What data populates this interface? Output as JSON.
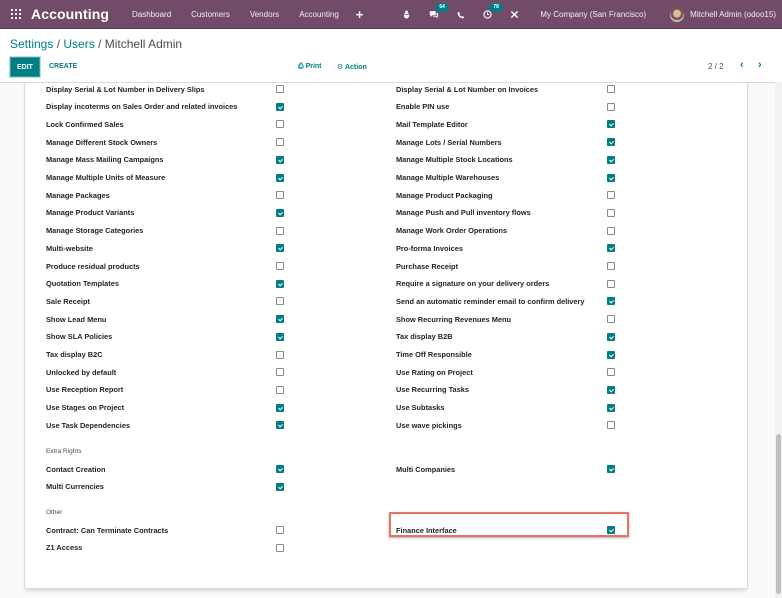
{
  "navbar": {
    "apps_icon": "apps-grid-icon",
    "brand": "Accounting",
    "menu": [
      "Dashboard",
      "Customers",
      "Vendors",
      "Accounting"
    ],
    "plus": "+",
    "icons": {
      "debug": "bug-icon",
      "messages": "chat-icon",
      "messages_count": "64",
      "phone": "phone-icon",
      "activities": "clock-icon",
      "activities_count": "78",
      "tools": "tools-icon"
    },
    "company": "My Company (San Francisco)",
    "user": "Mitchell Admin (odoo15)"
  },
  "breadcrumb": {
    "items": [
      "Settings",
      "Users"
    ],
    "separator": " / ",
    "current": "Mitchell Admin"
  },
  "toolbar": {
    "edit": "EDIT",
    "create": "CREATE",
    "print": "Print",
    "action": "Action",
    "print_icon": "⎙",
    "action_icon": "⚙",
    "pager": "2 / 2",
    "prev": "‹",
    "next": "›"
  },
  "permissions": {
    "left": [
      {
        "label": "Display Serial & Lot Number in Delivery Slips",
        "checked": false
      },
      {
        "label": "Display incoterms on Sales Order and related invoices",
        "checked": true
      },
      {
        "label": "Lock Confirmed Sales",
        "checked": false
      },
      {
        "label": "Manage Different Stock Owners",
        "checked": false
      },
      {
        "label": "Manage Mass Mailing Campaigns",
        "checked": true
      },
      {
        "label": "Manage Multiple Units of Measure",
        "checked": true
      },
      {
        "label": "Manage Packages",
        "checked": false
      },
      {
        "label": "Manage Product Variants",
        "checked": true
      },
      {
        "label": "Manage Storage Categories",
        "checked": false
      },
      {
        "label": "Multi-website",
        "checked": true
      },
      {
        "label": "Produce residual products",
        "checked": false
      },
      {
        "label": "Quotation Templates",
        "checked": true
      },
      {
        "label": "Sale Receipt",
        "checked": false
      },
      {
        "label": "Show Lead Menu",
        "checked": true
      },
      {
        "label": "Show SLA Policies",
        "checked": true
      },
      {
        "label": "Tax display B2C",
        "checked": false
      },
      {
        "label": "Unlocked by default",
        "checked": false
      },
      {
        "label": "Use Reception Report",
        "checked": false
      },
      {
        "label": "Use Stages on Project",
        "checked": true
      },
      {
        "label": "Use Task Dependencies",
        "checked": true
      }
    ],
    "right": [
      {
        "label": "Display Serial & Lot Number on Invoices",
        "checked": false
      },
      {
        "label": "Enable PIN use",
        "checked": false
      },
      {
        "label": "Mail Template Editor",
        "checked": true
      },
      {
        "label": "Manage Lots / Serial Numbers",
        "checked": true
      },
      {
        "label": "Manage Multiple Stock Locations",
        "checked": true
      },
      {
        "label": "Manage Multiple Warehouses",
        "checked": true
      },
      {
        "label": "Manage Product Packaging",
        "checked": false
      },
      {
        "label": "Manage Push and Pull inventory flows",
        "checked": false
      },
      {
        "label": "Manage Work Order Operations",
        "checked": false
      },
      {
        "label": "Pro-forma Invoices",
        "checked": true
      },
      {
        "label": "Purchase Receipt",
        "checked": false
      },
      {
        "label": "Require a signature on your delivery orders",
        "checked": false
      },
      {
        "label": "Send an automatic reminder email to confirm delivery",
        "checked": true
      },
      {
        "label": "Show Recurring Revenues Menu",
        "checked": false
      },
      {
        "label": "Tax display B2B",
        "checked": true
      },
      {
        "label": "Time Off Responsible",
        "checked": true
      },
      {
        "label": "Use Rating on Project",
        "checked": false
      },
      {
        "label": "Use Recurring Tasks",
        "checked": true
      },
      {
        "label": "Use Subtasks",
        "checked": true
      },
      {
        "label": "Use wave pickings",
        "checked": false
      }
    ]
  },
  "extra_rights": {
    "title": "Extra Rights",
    "left": [
      {
        "label": "Contact Creation",
        "checked": true
      },
      {
        "label": "Multi Currencies",
        "checked": true
      }
    ],
    "right": [
      {
        "label": "Multi Companies",
        "checked": true
      }
    ]
  },
  "other": {
    "title": "Other",
    "left": [
      {
        "label": "Contract: Can Terminate Contracts",
        "checked": false
      },
      {
        "label": "Z1 Access",
        "checked": false
      }
    ],
    "right": [
      {
        "label": "Finance Interface",
        "checked": true,
        "highlighted": true
      }
    ]
  },
  "colors": {
    "brand": "#714b67",
    "accent": "#017e84",
    "highlight": "#e57368"
  }
}
